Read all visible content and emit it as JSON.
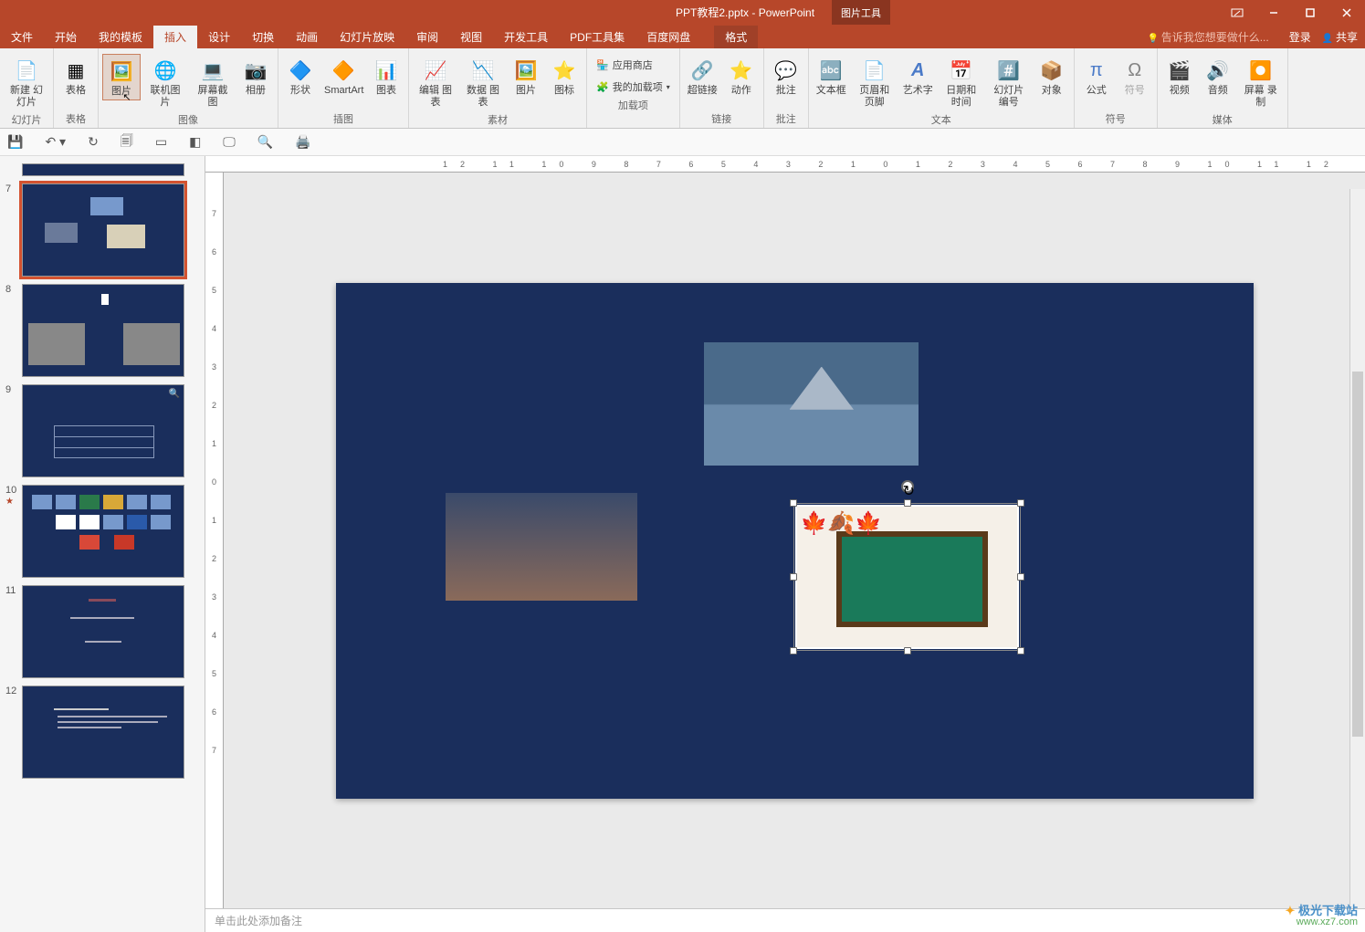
{
  "title": "PPT教程2.pptx - PowerPoint",
  "context_tool_group": "图片工具",
  "context_tool_tab": "格式",
  "tabs": [
    "文件",
    "开始",
    "我的模板",
    "插入",
    "设计",
    "切换",
    "动画",
    "幻灯片放映",
    "审阅",
    "视图",
    "开发工具",
    "PDF工具集",
    "百度网盘"
  ],
  "active_tab_index": 3,
  "tellme_placeholder": "告诉我您想要做什么...",
  "login_label": "登录",
  "share_label": "共享",
  "ribbon": {
    "slides": {
      "new_slide": "新建\n幻灯片",
      "group": "幻灯片"
    },
    "tables": {
      "table": "表格",
      "group": "表格"
    },
    "images": {
      "picture": "图片",
      "online_picture": "联机图片",
      "screenshot": "屏幕截图",
      "album": "相册",
      "group": "图像"
    },
    "illus": {
      "shapes": "形状",
      "smartart": "SmartArt",
      "chart": "图表",
      "group": "插图"
    },
    "assets": {
      "edit_chart": "编辑\n图表",
      "data_chart": "数据\n图表",
      "pic": "图片",
      "icon": "图标",
      "group": "素材"
    },
    "addins": {
      "store": "应用商店",
      "myaddins": "我的加载项",
      "group": "加载项"
    },
    "links": {
      "hyperlink": "超链接",
      "action": "动作",
      "group": "链接"
    },
    "comments": {
      "comment": "批注",
      "group": "批注"
    },
    "text": {
      "textbox": "文本框",
      "header_footer": "页眉和页脚",
      "wordart": "艺术字",
      "datetime": "日期和时间",
      "slide_number": "幻灯片\n编号",
      "object": "对象",
      "group": "文本"
    },
    "symbols": {
      "equation": "公式",
      "symbol": "符号",
      "group": "符号"
    },
    "media": {
      "video": "视频",
      "audio": "音频",
      "screen_rec": "屏幕\n录制",
      "group": "媒体"
    }
  },
  "thumbnails": [
    {
      "num": "7",
      "selected": true
    },
    {
      "num": "8"
    },
    {
      "num": "9"
    },
    {
      "num": "10",
      "has_star": true
    },
    {
      "num": "11"
    },
    {
      "num": "12"
    }
  ],
  "ruler_marks_h": "12 11 10 9 8 7 6 5 4 3 2 1 0 1 2 3 4 5 6 7 8 9 10 11 12",
  "ruler_marks_v": [
    "7",
    "6",
    "5",
    "4",
    "3",
    "2",
    "1",
    "0",
    "1",
    "2",
    "3",
    "4",
    "5",
    "6",
    "7"
  ],
  "notes_placeholder": "单击此处添加备注",
  "watermark": {
    "cn": "极光下载站",
    "url": "www.xz7.com"
  }
}
